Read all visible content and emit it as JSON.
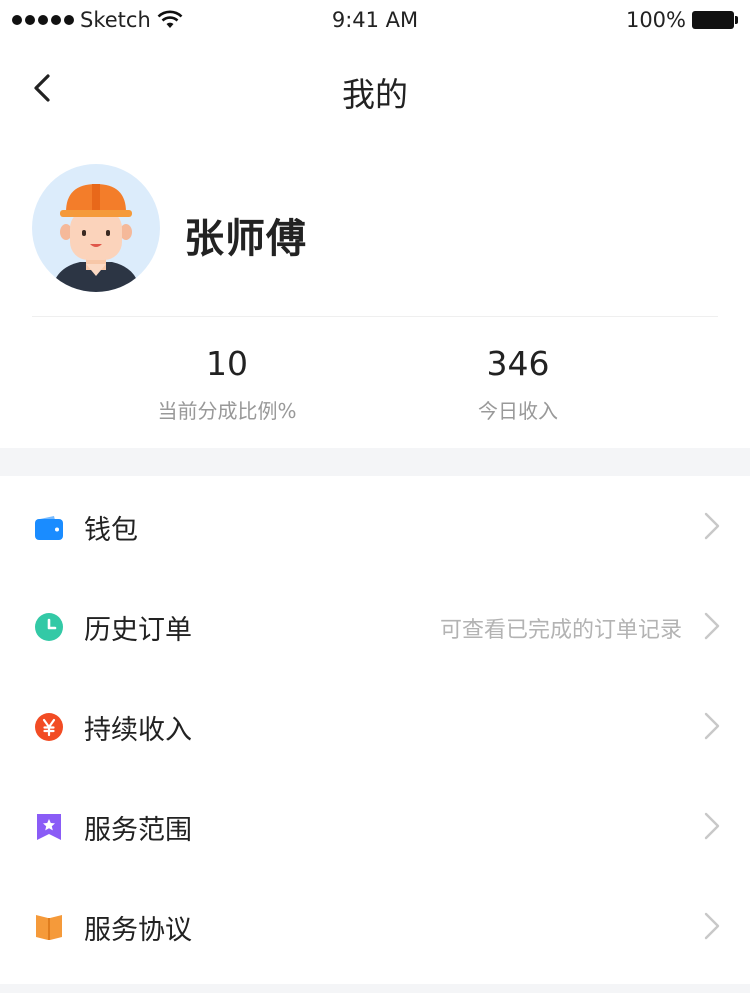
{
  "status_bar": {
    "carrier": "Sketch",
    "time": "9:41 AM",
    "battery": "100%"
  },
  "nav": {
    "title": "我的",
    "back_icon": "chevron-left-icon"
  },
  "profile": {
    "name": "张师傅",
    "avatar_icon": "worker-avatar-icon",
    "stats": [
      {
        "value": "10",
        "label": "当前分成比例%"
      },
      {
        "value": "346",
        "label": "今日收入"
      }
    ]
  },
  "menu": {
    "items": [
      {
        "label": "钱包",
        "hint": "",
        "icon": "wallet-icon",
        "color": "#1a8cff"
      },
      {
        "label": "历史订单",
        "hint": "可查看已完成的订单记录",
        "icon": "clock-icon",
        "color": "#33c9a6"
      },
      {
        "label": "持续收入",
        "hint": "",
        "icon": "yen-icon",
        "color": "#f24c24"
      },
      {
        "label": "服务范围",
        "hint": "",
        "icon": "badge-star-icon",
        "color": "#8a5cf6"
      },
      {
        "label": "服务协议",
        "hint": "",
        "icon": "book-icon",
        "color": "#f59a3a"
      }
    ]
  }
}
